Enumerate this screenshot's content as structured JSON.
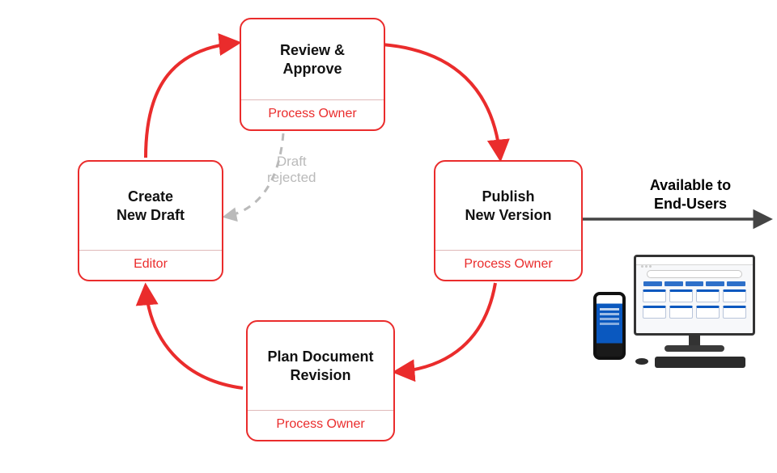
{
  "nodes": {
    "review_approve": {
      "title": "Review &\nApprove",
      "role": "Process Owner"
    },
    "publish": {
      "title": "Publish\nNew Version",
      "role": "Process Owner"
    },
    "plan_revision": {
      "title": "Plan Document\nRevision",
      "role": "Process Owner"
    },
    "create_draft": {
      "title": "Create\nNew Draft",
      "role": "Editor"
    }
  },
  "labels": {
    "draft_rejected": "Draft\nrejected",
    "end_users": "Available to\nEnd-Users"
  },
  "chart_data": {
    "type": "flow",
    "title": "",
    "nodes": [
      {
        "id": "review_approve",
        "label": "Review & Approve",
        "role": "Process Owner"
      },
      {
        "id": "publish",
        "label": "Publish New Version",
        "role": "Process Owner"
      },
      {
        "id": "plan_revision",
        "label": "Plan Document Revision",
        "role": "Process Owner"
      },
      {
        "id": "create_draft",
        "label": "Create New Draft",
        "role": "Editor"
      }
    ],
    "edges": [
      {
        "from": "create_draft",
        "to": "review_approve",
        "style": "solid",
        "color": "#ea2c2c"
      },
      {
        "from": "review_approve",
        "to": "publish",
        "style": "solid",
        "color": "#ea2c2c"
      },
      {
        "from": "publish",
        "to": "plan_revision",
        "style": "solid",
        "color": "#ea2c2c"
      },
      {
        "from": "plan_revision",
        "to": "create_draft",
        "style": "solid",
        "color": "#ea2c2c"
      },
      {
        "from": "review_approve",
        "to": "create_draft",
        "style": "dashed",
        "color": "#bababa",
        "label": "Draft rejected"
      },
      {
        "from": "publish",
        "to": "end_users",
        "style": "solid",
        "color": "#444",
        "label": "Available to End-Users"
      }
    ]
  }
}
